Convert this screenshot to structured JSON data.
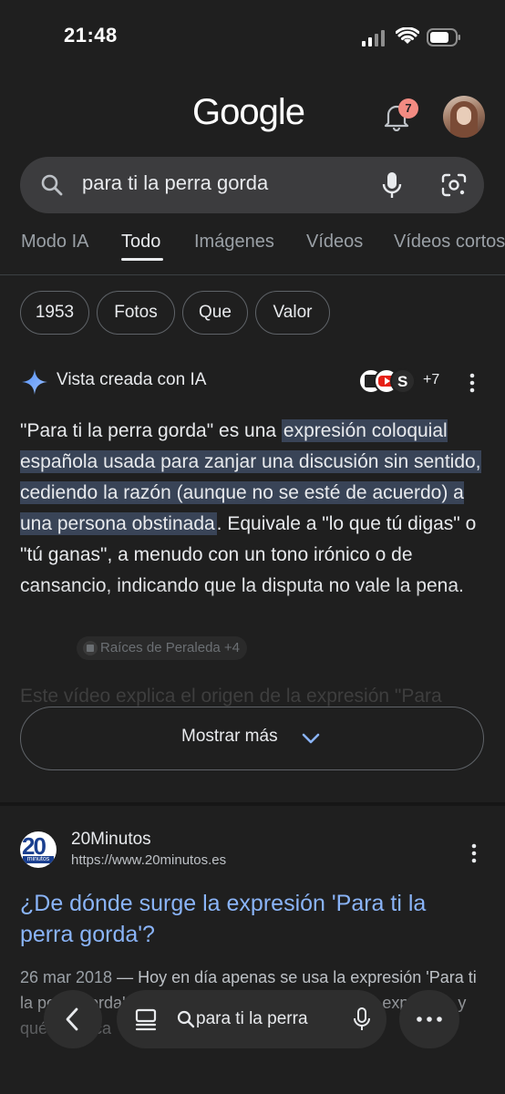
{
  "status_bar": {
    "time": "21:48"
  },
  "header": {
    "logo": "Google",
    "notification_count": "7"
  },
  "search": {
    "query": "para ti la perra gorda"
  },
  "tabs": [
    {
      "label": "Modo IA"
    },
    {
      "label": "Todo"
    },
    {
      "label": "Imágenes"
    },
    {
      "label": "Vídeos"
    },
    {
      "label": "Vídeos cortos"
    }
  ],
  "chips": [
    {
      "label": "1953"
    },
    {
      "label": "Fotos"
    },
    {
      "label": "Que"
    },
    {
      "label": "Valor"
    }
  ],
  "ai_overview": {
    "title": "Vista creada con IA",
    "sources_more": "+7",
    "text_before": "\"Para ti la perra gorda\" es una ",
    "text_highlight": "expresión coloquial española usada para zanjar una discusión sin sentido, cediendo la razón (aunque no se esté de acuerdo) a una persona obstinada",
    "text_after": ". Equivale a \"lo que tú digas\" o \"tú ganas\", a menudo con un tono irónico o de cansancio, indicando que la disputa no vale la pena.",
    "citation": "Raíces de Peraleda +4",
    "next_line": "Este vídeo explica el origen de la expresión \"Para",
    "show_more": "Mostrar más"
  },
  "result": {
    "site_name": "20Minutos",
    "favicon_text": "20",
    "favicon_sub": "minutos",
    "url": "https://www.20minutos.es",
    "title": "¿De dónde surge la expresión 'Para ti la perra gorda'?",
    "date": "26 mar 2018",
    "snippet": " — Hoy en día apenas se usa la expresión 'Para ti la perra gorda'. Vamos a ver de dónde viene esta expresión y qué significa"
  },
  "browser_bar": {
    "address": "para ti la perra gorda"
  },
  "colors": {
    "background": "#1f1f1f",
    "link": "#8ab4f8",
    "highlight": "#394457",
    "badge": "#f28b82"
  }
}
